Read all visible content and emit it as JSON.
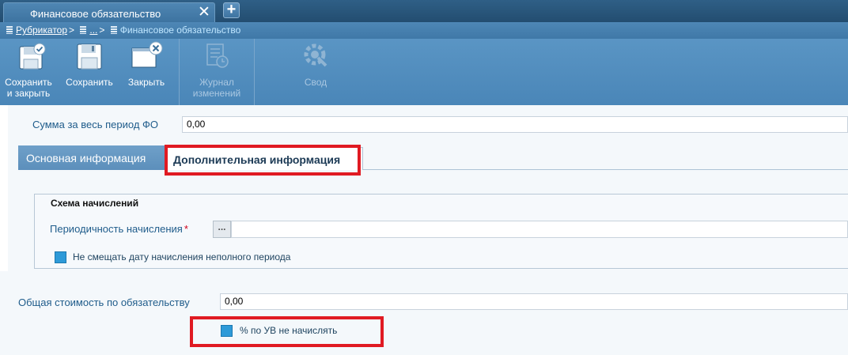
{
  "tab": {
    "title": "Финансовое обязательство",
    "close_glyph": "✕",
    "add_glyph": "+"
  },
  "breadcrumb": {
    "root": "Рубрикатор",
    "middle": "...",
    "current": "Финансовое обязательство",
    "separator": ">"
  },
  "toolbar": {
    "save_close_line1": "Сохранить",
    "save_close_line2": "и закрыть",
    "save": "Сохранить",
    "close": "Закрыть",
    "journal_line1": "Журнал",
    "journal_line2": "изменений",
    "summary": "Свод"
  },
  "form": {
    "sum_label": "Сумма за весь период ФО",
    "sum_value": "0,00",
    "tabs": {
      "main": "Основная информация",
      "additional": "Дополнительная информация"
    },
    "schema": {
      "legend": "Схема начислений",
      "periodicity_label": "Периодичность начисления",
      "required_mark": "*",
      "lookup_glyph": "...",
      "no_shift_label": "Не смещать дату начисления неполного периода"
    },
    "total_label": "Общая стоимость по обязательству",
    "total_value": "0,00",
    "no_accrual_label": "% по УВ не начислять"
  },
  "colors": {
    "highlight": "#e01a22",
    "checkbox": "#2e9ad8",
    "label": "#1f5c8b"
  }
}
